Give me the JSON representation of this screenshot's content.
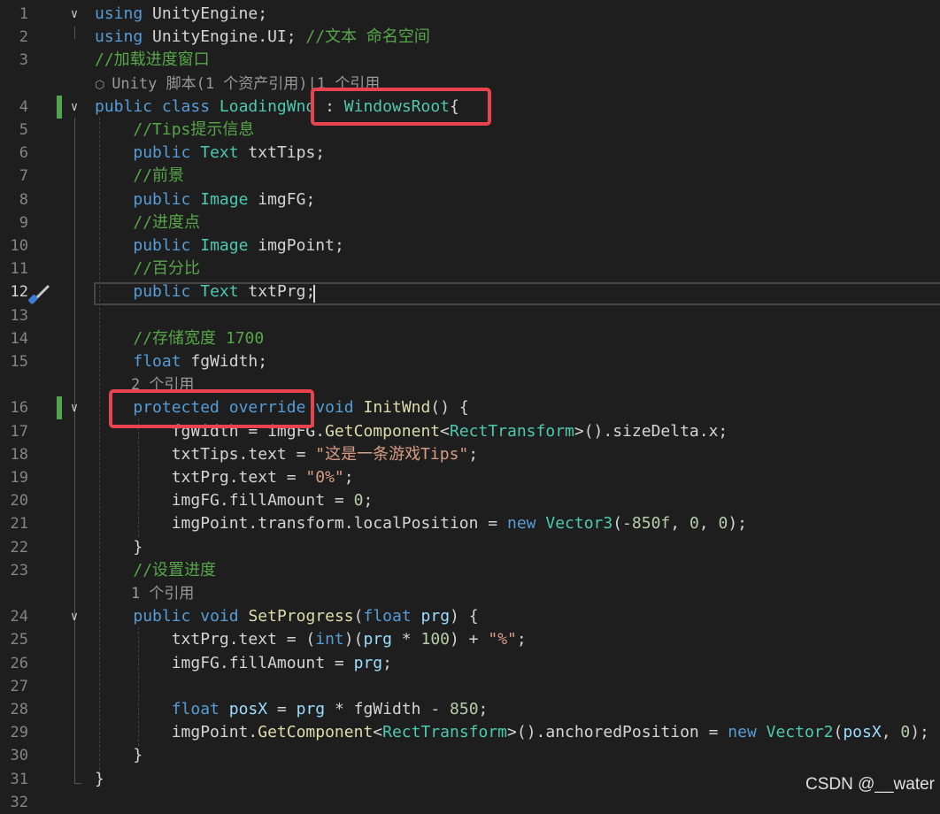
{
  "lines": [
    {
      "ln": "1",
      "fold": "open",
      "tokens": [
        [
          "k",
          "using"
        ],
        [
          "p",
          " UnityEngine;"
        ]
      ]
    },
    {
      "ln": "2",
      "tokens": [
        [
          "k",
          "using"
        ],
        [
          "p",
          " UnityEngine.UI; "
        ],
        [
          "c",
          "//文本 命名空间"
        ]
      ]
    },
    {
      "ln": "3",
      "tokens": [
        [
          "c",
          "//加载进度窗口"
        ]
      ]
    },
    {
      "lens": "Unity 脚本(1 个资产引用)|1 个引用",
      "lensIcon": true
    },
    {
      "ln": "4",
      "fold": "open",
      "bar": true,
      "tokens": [
        [
          "k",
          "public"
        ],
        [
          "p",
          " "
        ],
        [
          "k",
          "class"
        ],
        [
          "p",
          " "
        ],
        [
          "t",
          "LoadingWnd"
        ],
        [
          "p",
          " : "
        ],
        [
          "t",
          "WindowsRoot"
        ],
        [
          "p",
          "{"
        ]
      ]
    },
    {
      "ln": "5",
      "tokens": [
        [
          "p",
          "    "
        ],
        [
          "c",
          "//Tips提示信息"
        ]
      ]
    },
    {
      "ln": "6",
      "tokens": [
        [
          "p",
          "    "
        ],
        [
          "k",
          "public"
        ],
        [
          "p",
          " "
        ],
        [
          "t",
          "Text"
        ],
        [
          "p",
          " txtTips;"
        ]
      ]
    },
    {
      "ln": "7",
      "tokens": [
        [
          "p",
          "    "
        ],
        [
          "c",
          "//前景"
        ]
      ]
    },
    {
      "ln": "8",
      "tokens": [
        [
          "p",
          "    "
        ],
        [
          "k",
          "public"
        ],
        [
          "p",
          " "
        ],
        [
          "t",
          "Image"
        ],
        [
          "p",
          " imgFG;"
        ]
      ]
    },
    {
      "ln": "9",
      "tokens": [
        [
          "p",
          "    "
        ],
        [
          "c",
          "//进度点"
        ]
      ]
    },
    {
      "ln": "10",
      "tokens": [
        [
          "p",
          "    "
        ],
        [
          "k",
          "public"
        ],
        [
          "p",
          " "
        ],
        [
          "t",
          "Image"
        ],
        [
          "p",
          " imgPoint;"
        ]
      ]
    },
    {
      "ln": "11",
      "tokens": [
        [
          "p",
          "    "
        ],
        [
          "c",
          "//百分比"
        ]
      ]
    },
    {
      "ln": "12",
      "active": true,
      "tokens": [
        [
          "p",
          "    "
        ],
        [
          "k",
          "public"
        ],
        [
          "p",
          " "
        ],
        [
          "t",
          "Text"
        ],
        [
          "p",
          " txtPrg;"
        ]
      ]
    },
    {
      "ln": "13",
      "tokens": []
    },
    {
      "ln": "14",
      "tokens": [
        [
          "p",
          "    "
        ],
        [
          "c",
          "//存储宽度 1700"
        ]
      ]
    },
    {
      "ln": "15",
      "tokens": [
        [
          "p",
          "    "
        ],
        [
          "k",
          "float"
        ],
        [
          "p",
          " fgWidth;"
        ]
      ]
    },
    {
      "lens": "    2 个引用"
    },
    {
      "ln": "16",
      "fold": "open",
      "bar": true,
      "tokens": [
        [
          "p",
          "    "
        ],
        [
          "k",
          "protected"
        ],
        [
          "p",
          " "
        ],
        [
          "k",
          "override"
        ],
        [
          "p",
          " "
        ],
        [
          "k",
          "void"
        ],
        [
          "p",
          " "
        ],
        [
          "f",
          "InitWnd"
        ],
        [
          "p",
          "() {"
        ]
      ]
    },
    {
      "ln": "17",
      "tokens": [
        [
          "p",
          "        fgWidth = imgFG."
        ],
        [
          "f",
          "GetComponent"
        ],
        [
          "p",
          "<"
        ],
        [
          "t",
          "RectTransform"
        ],
        [
          "p",
          ">().sizeDelta.x;"
        ]
      ]
    },
    {
      "ln": "18",
      "tokens": [
        [
          "p",
          "        txtTips.text = "
        ],
        [
          "s",
          "\"这是一条游戏Tips\""
        ],
        [
          "p",
          ";"
        ]
      ]
    },
    {
      "ln": "19",
      "tokens": [
        [
          "p",
          "        txtPrg.text = "
        ],
        [
          "s",
          "\"0%\""
        ],
        [
          "p",
          ";"
        ]
      ]
    },
    {
      "ln": "20",
      "tokens": [
        [
          "p",
          "        imgFG.fillAmount = "
        ],
        [
          "n",
          "0"
        ],
        [
          "p",
          ";"
        ]
      ]
    },
    {
      "ln": "21",
      "tokens": [
        [
          "p",
          "        imgPoint.transform.localPosition = "
        ],
        [
          "k",
          "new"
        ],
        [
          "p",
          " "
        ],
        [
          "t",
          "Vector3"
        ],
        [
          "p",
          "(-"
        ],
        [
          "n",
          "850f"
        ],
        [
          "p",
          ", "
        ],
        [
          "n",
          "0"
        ],
        [
          "p",
          ", "
        ],
        [
          "n",
          "0"
        ],
        [
          "p",
          ");"
        ]
      ]
    },
    {
      "ln": "22",
      "tokens": [
        [
          "p",
          "    }"
        ]
      ]
    },
    {
      "ln": "23",
      "tokens": [
        [
          "p",
          "    "
        ],
        [
          "c",
          "//设置进度"
        ]
      ]
    },
    {
      "lens": "    1 个引用"
    },
    {
      "ln": "24",
      "fold": "open",
      "tokens": [
        [
          "p",
          "    "
        ],
        [
          "k",
          "public"
        ],
        [
          "p",
          " "
        ],
        [
          "k",
          "void"
        ],
        [
          "p",
          " "
        ],
        [
          "f",
          "SetProgress"
        ],
        [
          "p",
          "("
        ],
        [
          "k",
          "float"
        ],
        [
          "p",
          " "
        ],
        [
          "v",
          "prg"
        ],
        [
          "p",
          ") {"
        ]
      ]
    },
    {
      "ln": "25",
      "tokens": [
        [
          "p",
          "        txtPrg.text = ("
        ],
        [
          "k",
          "int"
        ],
        [
          "p",
          ")("
        ],
        [
          "v",
          "prg"
        ],
        [
          "p",
          " * "
        ],
        [
          "n",
          "100"
        ],
        [
          "p",
          ") + "
        ],
        [
          "s",
          "\"%\""
        ],
        [
          "p",
          ";"
        ]
      ]
    },
    {
      "ln": "26",
      "tokens": [
        [
          "p",
          "        imgFG.fillAmount = "
        ],
        [
          "v",
          "prg"
        ],
        [
          "p",
          ";"
        ]
      ]
    },
    {
      "ln": "27",
      "tokens": []
    },
    {
      "ln": "28",
      "tokens": [
        [
          "p",
          "        "
        ],
        [
          "k",
          "float"
        ],
        [
          "p",
          " "
        ],
        [
          "v",
          "posX"
        ],
        [
          "p",
          " = "
        ],
        [
          "v",
          "prg"
        ],
        [
          "p",
          " * fgWidth - "
        ],
        [
          "n",
          "850"
        ],
        [
          "p",
          ";"
        ]
      ]
    },
    {
      "ln": "29",
      "tokens": [
        [
          "p",
          "        imgPoint."
        ],
        [
          "f",
          "GetComponent"
        ],
        [
          "p",
          "<"
        ],
        [
          "t",
          "RectTransform"
        ],
        [
          "p",
          ">().anchoredPosition = "
        ],
        [
          "k",
          "new"
        ],
        [
          "p",
          " "
        ],
        [
          "t",
          "Vector2"
        ],
        [
          "p",
          "("
        ],
        [
          "v",
          "posX"
        ],
        [
          "p",
          ", "
        ],
        [
          "n",
          "0"
        ],
        [
          "p",
          ");"
        ]
      ]
    },
    {
      "ln": "30",
      "tokens": [
        [
          "p",
          "    }"
        ]
      ]
    },
    {
      "ln": "31",
      "tokens": [
        [
          "p",
          "}"
        ]
      ]
    },
    {
      "ln": "32",
      "tokens": []
    }
  ],
  "highlights": [
    "WindowsRoot base class",
    "protected override"
  ],
  "watermark": "CSDN @__water",
  "colors": {
    "background": "#1e1e1e",
    "keyword": "#569cd6",
    "type": "#4ec9b0",
    "comment": "#57a64a",
    "string": "#d69d85",
    "number": "#b5cea8",
    "method": "#dcdcaa",
    "param": "#9cdcfe",
    "highlight": "#e8434f",
    "change": "#4fa64f"
  }
}
